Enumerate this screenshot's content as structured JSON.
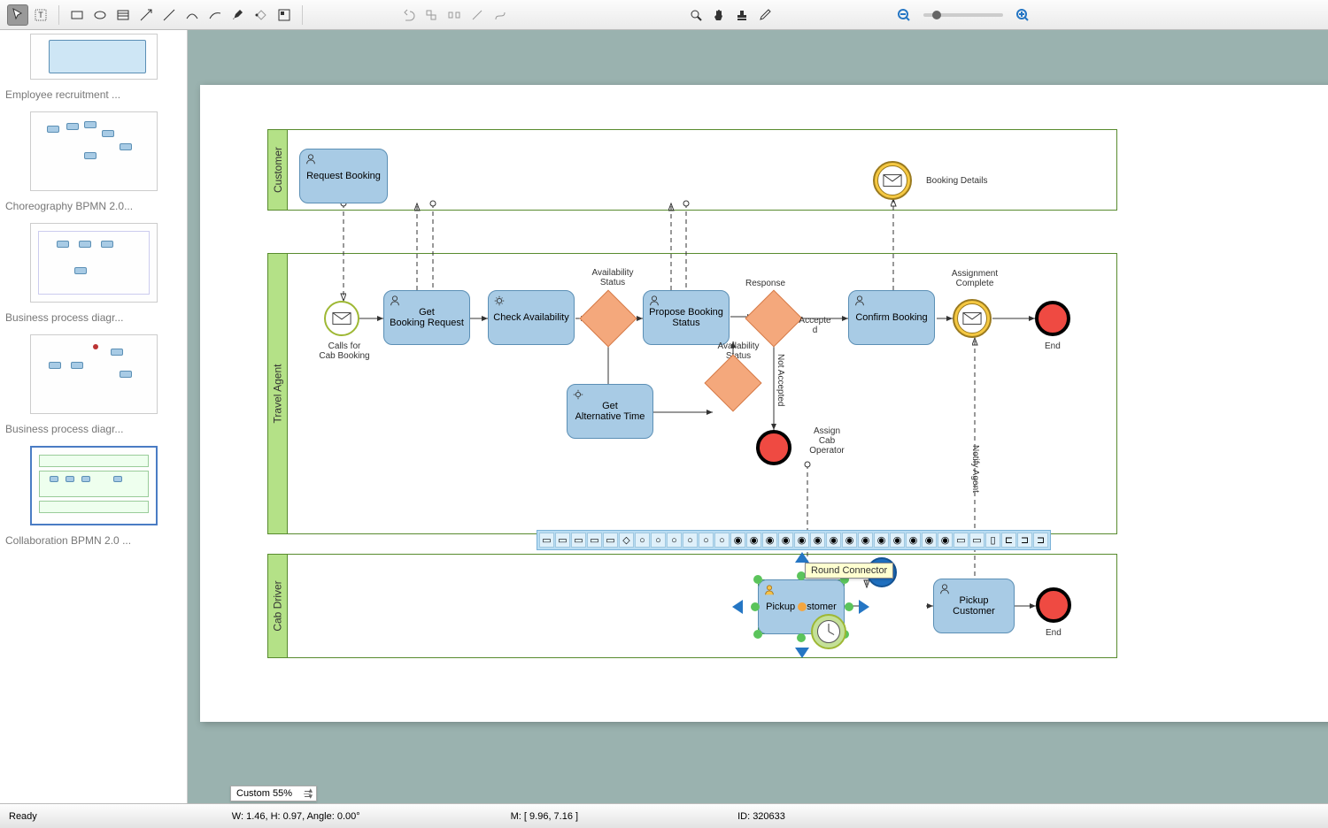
{
  "toolbar_icons": [
    "pointer",
    "text-tool",
    "rect",
    "ellipse",
    "table",
    "connector",
    "line",
    "curve",
    "arc",
    "pen",
    "shape-path",
    "library",
    "undo",
    "align",
    "distribute",
    "link",
    "auto-route",
    "zoom-window",
    "pan",
    "stamp",
    "eyedropper",
    "zoom-out",
    "zoom-in"
  ],
  "sidebar": {
    "items": [
      {
        "label": "Employee recruitment ..."
      },
      {
        "label": "Choreography BPMN 2.0..."
      },
      {
        "label": "Business process diagr..."
      },
      {
        "label": "Business process diagr..."
      },
      {
        "label": "Collaboration BPMN 2.0 ..."
      }
    ]
  },
  "diagram": {
    "pools": [
      {
        "name": "Customer"
      },
      {
        "name": "Travel Agent"
      },
      {
        "name": "Cab Driver"
      }
    ],
    "tasks": {
      "request_booking": "Request Booking",
      "get_booking_request": "Get\nBooking Request",
      "check_availability": "Check Availability",
      "propose_booking_status": "Propose Booking\nStatus",
      "get_alternative_time": "Get\nAlternative Time",
      "confirm_booking": "Confirm Booking",
      "pickup_customer_1": "Pickup Customer",
      "pickup_customer_2": "Pickup Customer"
    },
    "labels": {
      "calls_for_cab": "Calls for\nCab Booking",
      "availability_status": "Availability\nStatus",
      "response": "Response",
      "accepted": "Accepte\nd",
      "availability_status_2": "Availability\nStatus",
      "not_accepted": "Not Accepted",
      "assign_cab": "Assign\nCab\nOperator",
      "assignment_complete": "Assignment\nComplete",
      "booking_details": "Booking Details",
      "notify_agent": "Notify Agent",
      "end1": "End",
      "end2": "End"
    }
  },
  "tooltip": "Round Connector",
  "zoom": "Custom 55%",
  "status": {
    "ready": "Ready",
    "dims": "W: 1.46,  H: 0.97,  Angle: 0.00°",
    "mouse": "M: [ 9.96, 7.16 ]",
    "id": "ID: 320633"
  }
}
